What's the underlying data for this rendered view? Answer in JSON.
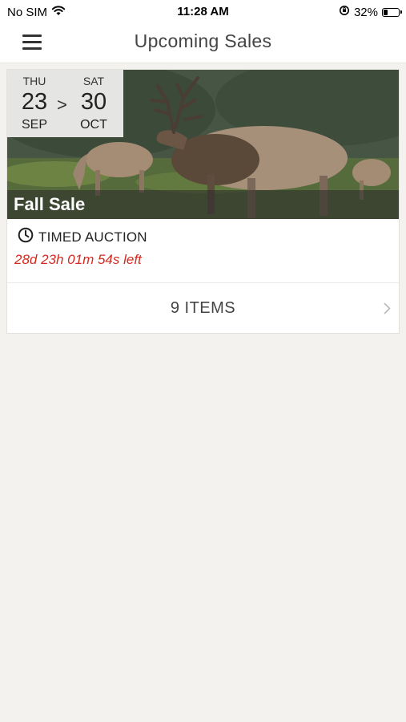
{
  "status_bar": {
    "carrier": "No SIM",
    "time": "11:28 AM",
    "battery": "32%",
    "battery_level": 0.32
  },
  "nav": {
    "title": "Upcoming Sales"
  },
  "sale": {
    "start": {
      "day": "THU",
      "date": "23",
      "month": "SEP"
    },
    "arrow": ">",
    "end": {
      "day": "SAT",
      "date": "30",
      "month": "OCT"
    },
    "title": "Fall Sale",
    "auction_type": "TIMED AUCTION",
    "time_left": "28d 23h 01m 54s left",
    "items_label": "9 ITEMS"
  },
  "colors": {
    "accent_red": "#d6281e",
    "background": "#f3f2ef"
  }
}
